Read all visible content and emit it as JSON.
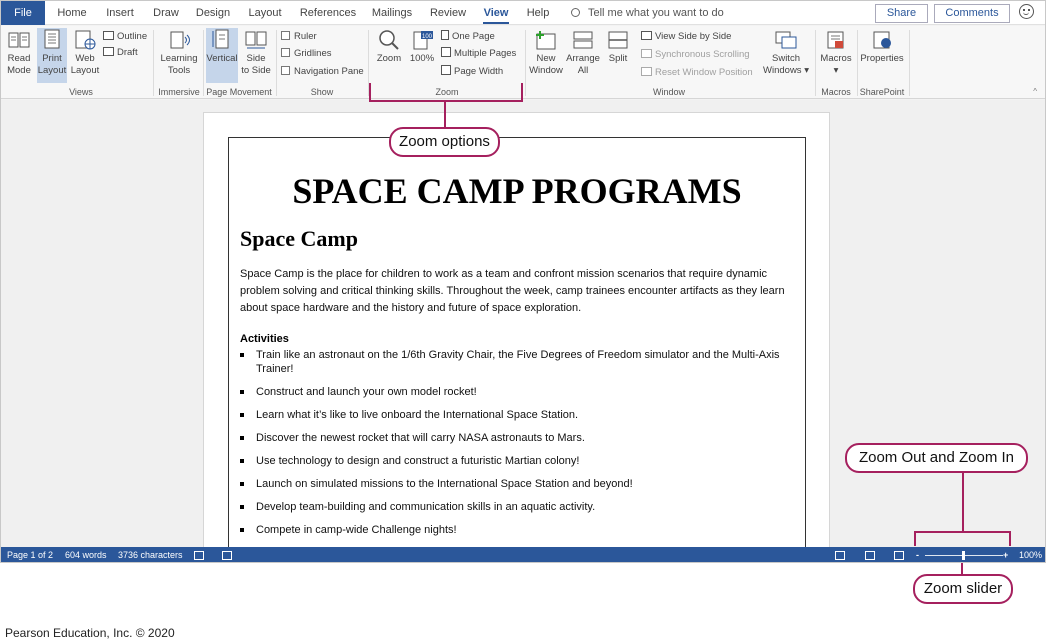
{
  "tabs": [
    {
      "label": "File"
    },
    {
      "label": "Home"
    },
    {
      "label": "Insert"
    },
    {
      "label": "Draw"
    },
    {
      "label": "Design"
    },
    {
      "label": "Layout"
    },
    {
      "label": "References"
    },
    {
      "label": "Mailings"
    },
    {
      "label": "Review"
    },
    {
      "label": "View"
    },
    {
      "label": "Help"
    }
  ],
  "active_tab": "View",
  "tell_me": "Tell me what you want to do",
  "share_label": "Share",
  "comments_label": "Comments",
  "ribbon": {
    "views": {
      "read_mode": "Read Mode",
      "read_1": "Read",
      "read_2": "Mode",
      "print_1": "Print",
      "print_2": "Layout",
      "web_1": "Web",
      "web_2": "Layout",
      "outline": "Outline",
      "draft": "Draft",
      "label": "Views"
    },
    "immersive": {
      "lt_1": "Learning",
      "lt_2": "Tools",
      "label": "Immersive"
    },
    "page_movement": {
      "vertical": "Vertical",
      "side_1": "Side",
      "side_2": "to Side",
      "label": "Page Movement"
    },
    "show": {
      "ruler": "Ruler",
      "gridlines": "Gridlines",
      "nav_pane": "Navigation Pane",
      "label": "Show"
    },
    "zoom": {
      "zoom": "Zoom",
      "pct": "100%",
      "one_page": "One Page",
      "multiple_pages": "Multiple Pages",
      "page_width": "Page Width",
      "label": "Zoom"
    },
    "window": {
      "new_1": "New",
      "new_2": "Window",
      "arrange_1": "Arrange",
      "arrange_2": "All",
      "split": "Split",
      "side_by_side": "View Side by Side",
      "sync_scroll": "Synchronous Scrolling",
      "reset_pos": "Reset Window Position",
      "switch_1": "Switch",
      "switch_2": "Windows",
      "label": "Window"
    },
    "macros": {
      "macros": "Macros",
      "label": "Macros"
    },
    "sharepoint": {
      "properties": "Properties",
      "label": "SharePoint"
    }
  },
  "document": {
    "title": "SPACE CAMP PROGRAMS",
    "heading": "Space Camp",
    "paragraph": "Space Camp is the place for children to work as a team and confront mission scenarios that require dynamic problem solving and critical thinking skills. Throughout the week, camp trainees encounter artifacts as they learn about space hardware and the history and future of space exploration.",
    "subheading": "Activities",
    "bullets": [
      "Train like an astronaut on the 1/6th Gravity Chair, the Five Degrees of Freedom simulator and the Multi-Axis Trainer!",
      "Construct and launch your own model rocket!",
      "Learn what it’s like to live onboard the International Space Station.",
      "Discover the newest rocket that will carry NASA astronauts to Mars.",
      "Use technology to design and construct a futuristic Martian colony!",
      "Launch on simulated missions to the International Space Station and beyond!",
      "Develop team-building and communication skills in an aquatic activity.",
      "Compete in camp-wide Challenge nights!"
    ]
  },
  "status": {
    "page": "Page 1 of 2",
    "words": "604 words",
    "chars": "3736 characters",
    "zoom_minus": "-",
    "zoom_plus": "+",
    "zoom_pct": "100%",
    "zoom_level_percent": 100
  },
  "callouts": {
    "zoom_options": "Zoom options",
    "zoom_out_in": "Zoom Out and Zoom In",
    "zoom_slider": "Zoom slider"
  },
  "credit": "Pearson Education, Inc. © 2020",
  "colors": {
    "brand": "#2b579a",
    "callout": "#a5205e",
    "selected": "#c5d5ea"
  }
}
